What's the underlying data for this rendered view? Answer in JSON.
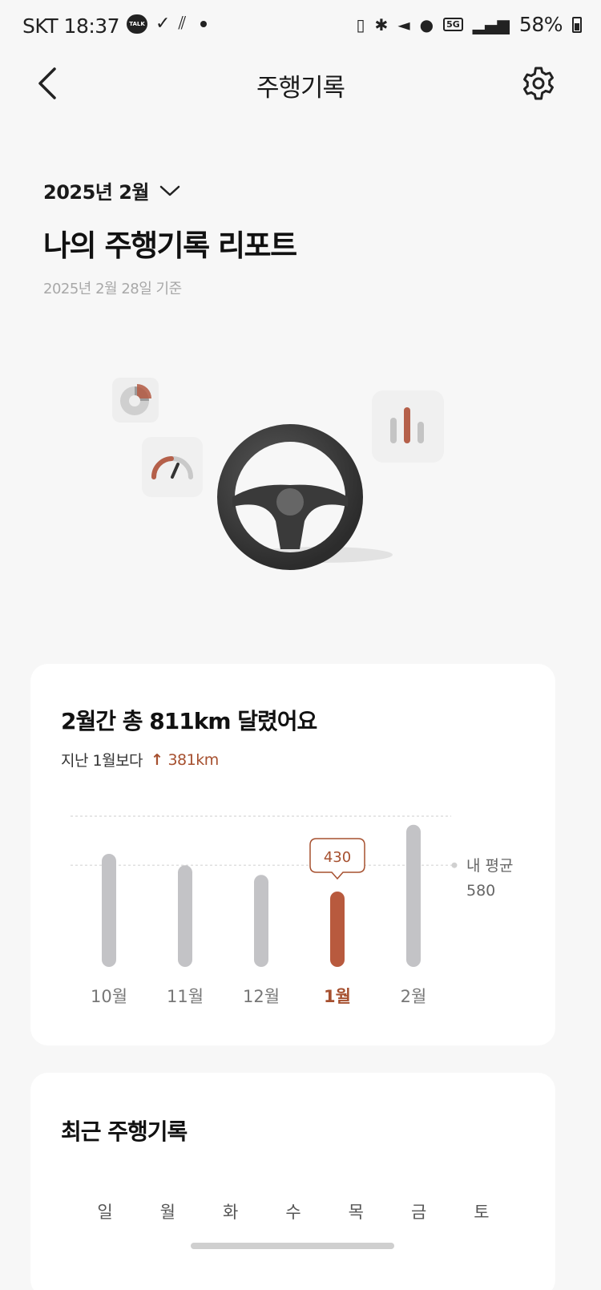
{
  "status_bar": {
    "carrier": "SKT",
    "time": "18:37",
    "talk_badge": "TALK",
    "network": "5G",
    "battery": "58%"
  },
  "header": {
    "title": "주행기록",
    "back_icon": "chevron-left-icon",
    "settings_icon": "gear-icon"
  },
  "report": {
    "month": "2025년 2월",
    "title": "나의 주행기록 리포트",
    "as_of": "2025년 2월 28일 기준"
  },
  "summary": {
    "title": "2월간 총 811km 달렸어요",
    "compare_label": "지난 1월보다",
    "compare_value": "381km",
    "accent_color": "#b85a3e"
  },
  "chart_data": {
    "type": "bar",
    "categories": [
      "10월",
      "11월",
      "12월",
      "1월",
      "2월"
    ],
    "values": [
      645,
      580,
      525,
      430,
      811
    ],
    "highlight_index": 3,
    "highlight_label": "430",
    "average_label": "내 평균",
    "average_value": 580,
    "ylim": [
      0,
      860
    ]
  },
  "recent": {
    "title": "최근 주행기록",
    "weekdays": [
      "일",
      "월",
      "화",
      "수",
      "목",
      "금",
      "토"
    ]
  }
}
